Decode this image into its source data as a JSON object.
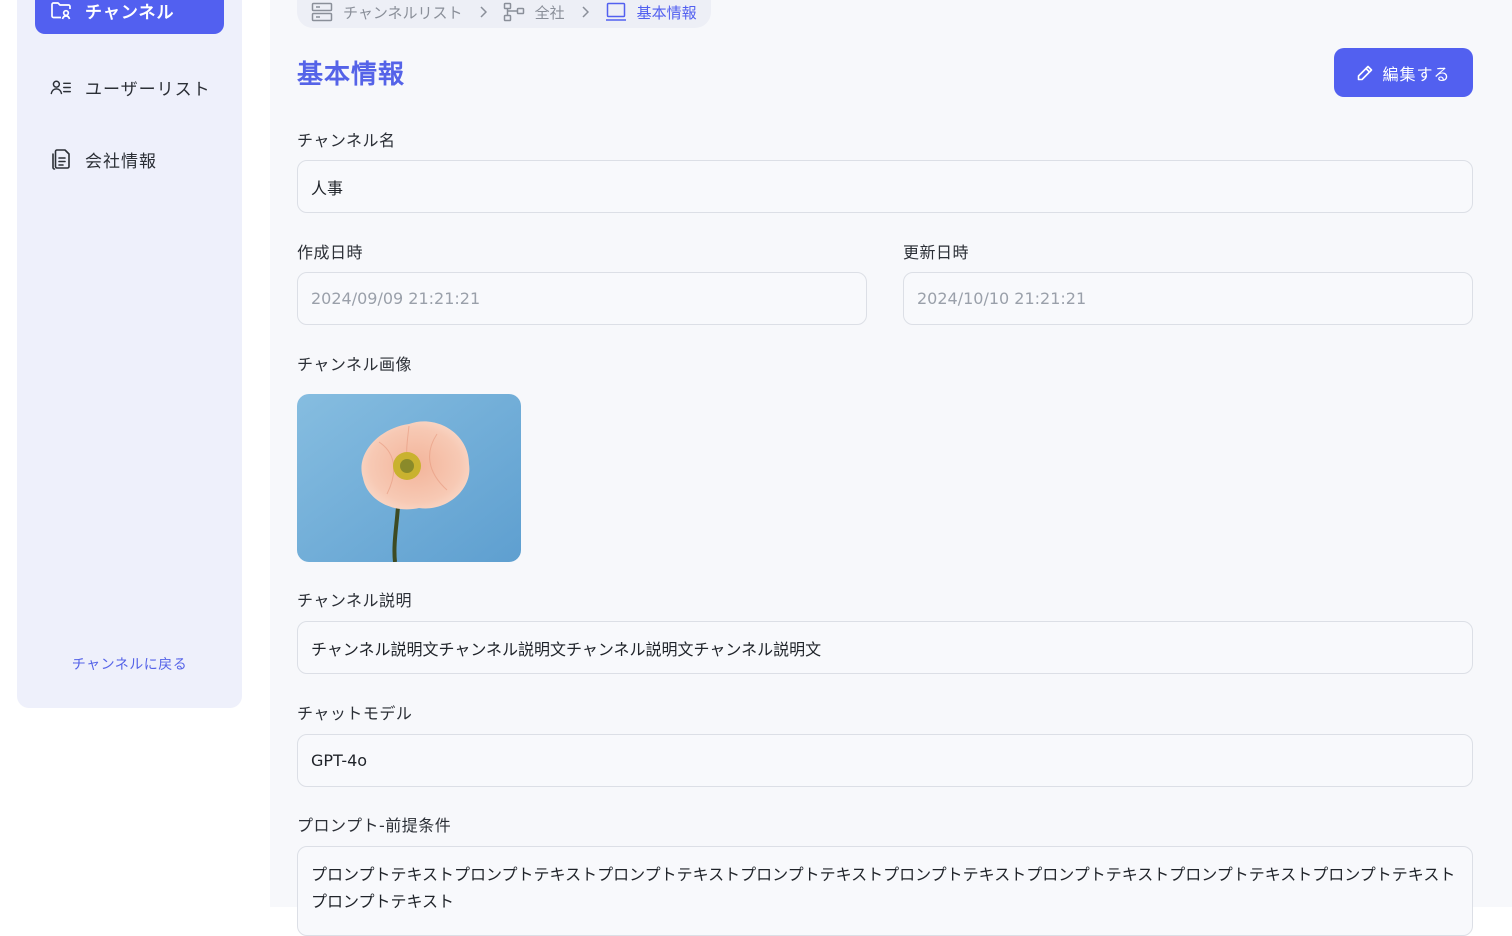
{
  "sidebar": {
    "items": [
      {
        "label": "チャンネル",
        "icon": "folder-user-icon",
        "active": true
      },
      {
        "label": "ユーザーリスト",
        "icon": "user-list-icon",
        "active": false
      },
      {
        "label": "会社情報",
        "icon": "document-icon",
        "active": false
      }
    ],
    "back_link": "チャンネルに戻る"
  },
  "breadcrumb": [
    {
      "label": "チャンネルリスト",
      "icon": "list-icon"
    },
    {
      "label": "全社",
      "icon": "hierarchy-icon"
    },
    {
      "label": "基本情報",
      "icon": "monitor-icon"
    }
  ],
  "page": {
    "title": "基本情報",
    "edit_label": "編集する"
  },
  "form": {
    "channel_name": {
      "label": "チャンネル名",
      "value": "人事"
    },
    "created_at": {
      "label": "作成日時",
      "value": "2024/09/09 21:21:21"
    },
    "updated_at": {
      "label": "更新日時",
      "value": "2024/10/10 21:21:21"
    },
    "channel_image": {
      "label": "チャンネル画像"
    },
    "description": {
      "label": "チャンネル説明",
      "value": "チャンネル説明文チャンネル説明文チャンネル説明文チャンネル説明文"
    },
    "chat_model": {
      "label": "チャットモデル",
      "value": "GPT-4o"
    },
    "prompt": {
      "label": "プロンプト-前提条件",
      "value": "プロンプトテキストプロンプトテキストプロンプトテキストプロンプトテキストプロンプトテキストプロンプトテキストプロンプトテキストプロンプトテキストプロンプトテキスト"
    }
  },
  "colors": {
    "accent": "#5260f0",
    "sidebar_bg": "#eef0fb",
    "main_bg": "#f7f8fb"
  }
}
